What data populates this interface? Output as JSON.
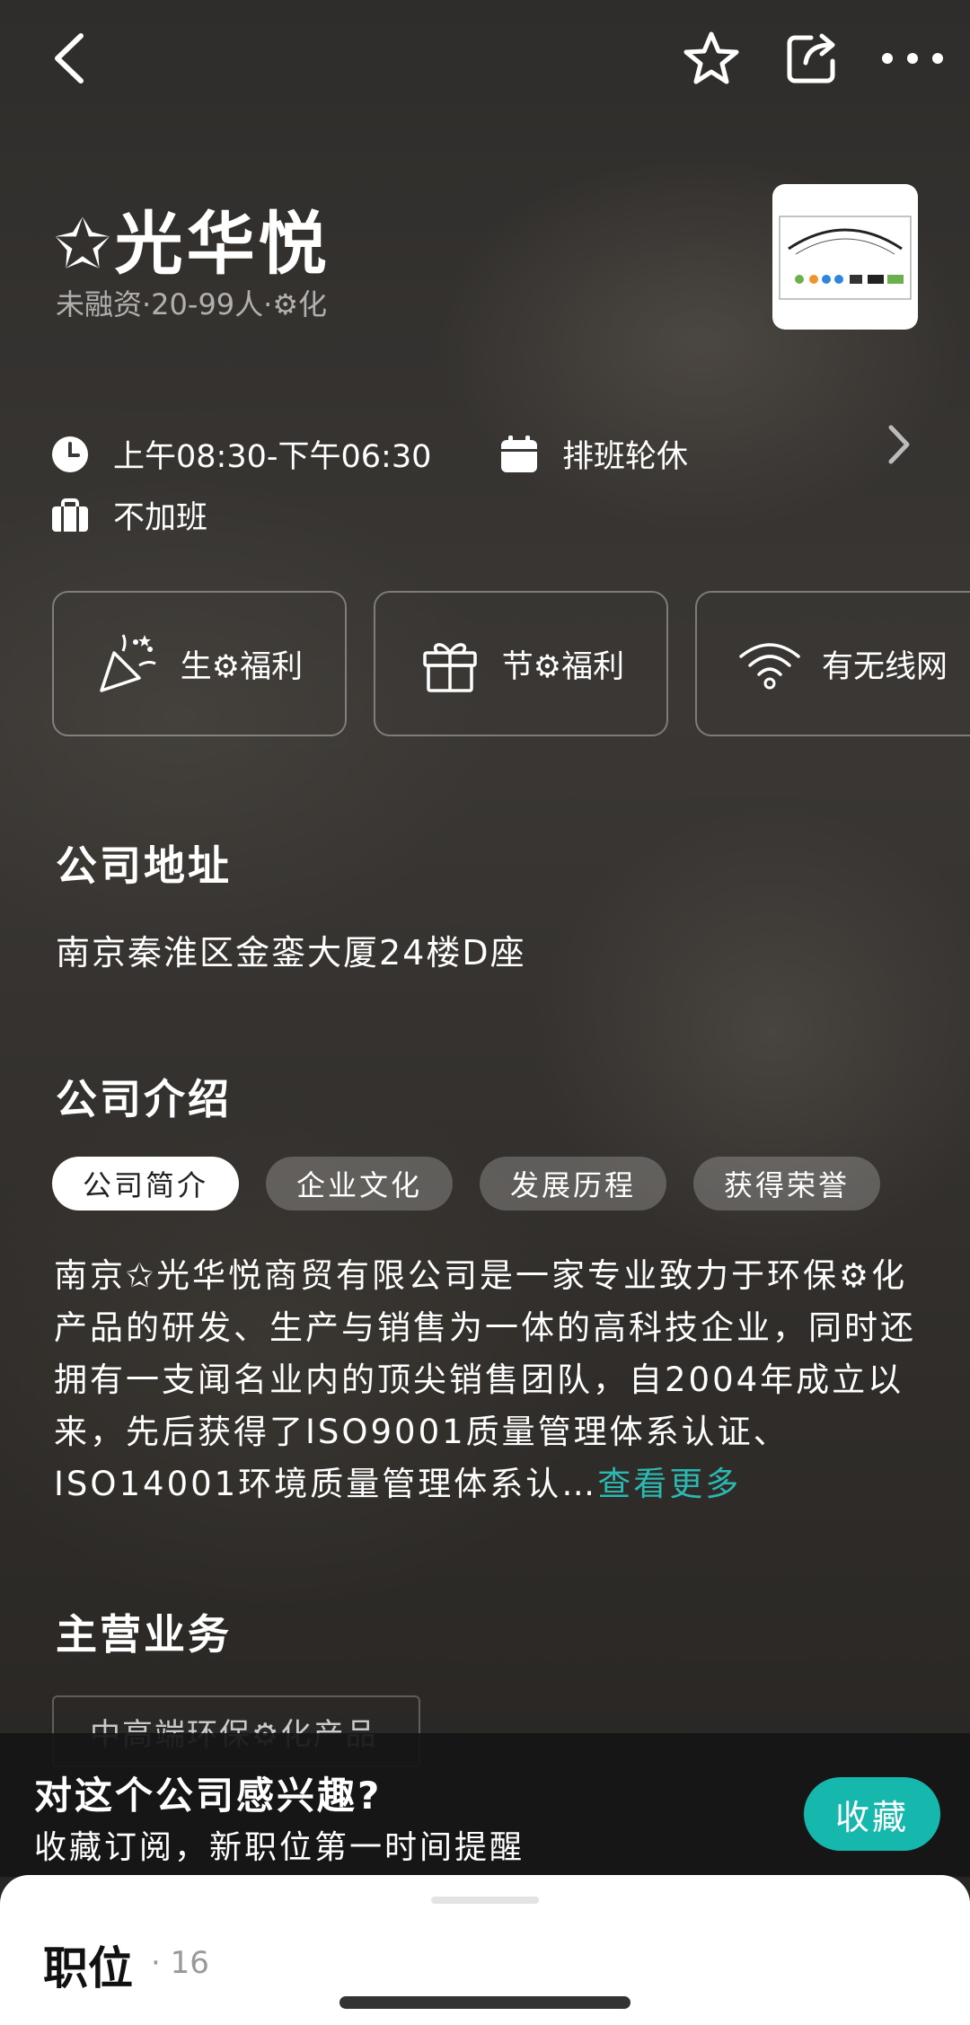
{
  "company": {
    "name": "✩光华悦",
    "meta": "未融资·20-99人·⚙化"
  },
  "work": {
    "hours": "上午08:30-下午06:30",
    "schedule": "排班轮休",
    "overtime": "不加班"
  },
  "benefits": [
    {
      "label": "生⚙福利",
      "icon": "party-popper-icon"
    },
    {
      "label": "节⚙福利",
      "icon": "gift-icon"
    },
    {
      "label": "有无线网",
      "icon": "wifi-icon"
    }
  ],
  "address": {
    "title": "公司地址",
    "text": "南京秦淮区金銮大厦24楼D座"
  },
  "intro": {
    "title": "公司介绍",
    "tabs": [
      "公司简介",
      "企业文化",
      "发展历程",
      "获得荣誉"
    ],
    "active_tab": 0,
    "text": "南京✩光华悦商贸有限公司是一家专业致力于环保⚙化产品的研发、生产与销售为一体的高科技企业，同时还拥有一支闻名业内的顶尖销售团队，自2004年成立以来，先后获得了ISO9001质量管理体系认证、ISO14001环境质量管理体系认…",
    "more": "查看更多"
  },
  "business": {
    "title": "主营业务",
    "tag": "中高端环保⚙化产品"
  },
  "subscribe": {
    "title": "对这个公司感兴趣?",
    "desc": "收藏订阅，新职位第一时间提醒",
    "button": "收藏"
  },
  "jobs": {
    "title": "职位",
    "count": "· 16"
  },
  "colors": {
    "accent": "#16b8ae",
    "link": "#2bb8b0"
  }
}
